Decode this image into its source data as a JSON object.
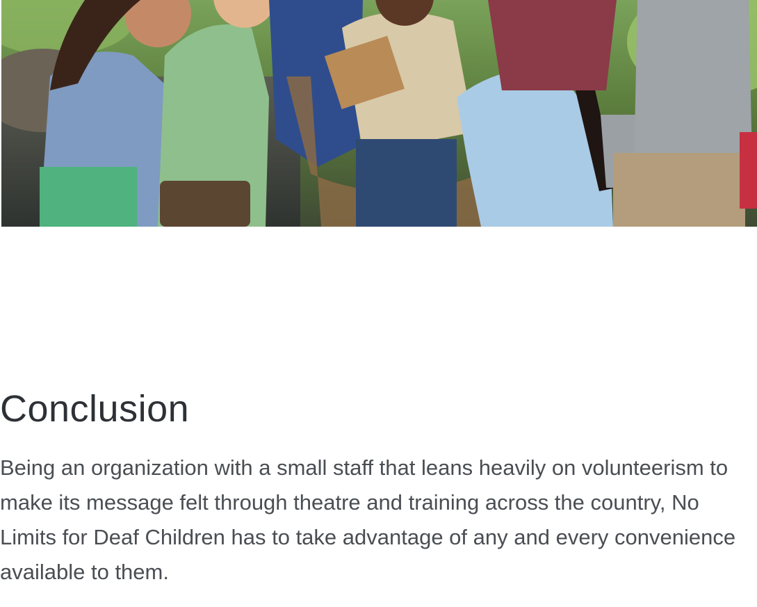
{
  "article": {
    "heading": "Conclusion",
    "paragraph": "Being an organization with a small staff that leans heavily on volunteerism to make its message felt through theatre and training across the country, No Limits for Deaf Children has to take advantage of any and every convenience available to them."
  },
  "colors": {
    "heading": "#2d3136",
    "body_text": "#4a4e53",
    "background": "#ffffff"
  }
}
